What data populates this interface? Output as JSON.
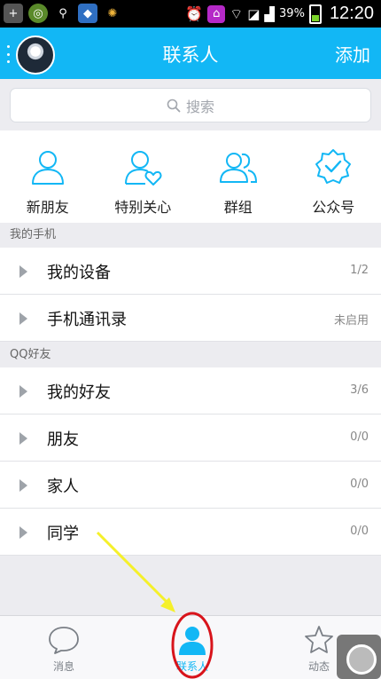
{
  "status_bar": {
    "battery_pct": "39%",
    "time": "12:20"
  },
  "header": {
    "title": "联系人",
    "add_label": "添加"
  },
  "search": {
    "placeholder": "搜索"
  },
  "quick_entries": [
    {
      "label": "新朋友",
      "icon": "person-icon"
    },
    {
      "label": "特别关心",
      "icon": "person-heart-icon"
    },
    {
      "label": "群组",
      "icon": "group-icon"
    },
    {
      "label": "公众号",
      "icon": "badge-check-icon"
    }
  ],
  "sections": [
    {
      "title": "我的手机",
      "rows": [
        {
          "name": "我的设备",
          "count": "1/2"
        },
        {
          "name": "手机通讯录",
          "count": "未启用"
        }
      ]
    },
    {
      "title": "QQ好友",
      "rows": [
        {
          "name": "我的好友",
          "count": "3/6"
        },
        {
          "name": "朋友",
          "count": "0/0"
        },
        {
          "name": "家人",
          "count": "0/0"
        },
        {
          "name": "同学",
          "count": "0/0"
        }
      ]
    }
  ],
  "tabs": [
    {
      "label": "消息",
      "icon": "chat-bubble-icon",
      "active": false
    },
    {
      "label": "联系人",
      "icon": "contact-person-icon",
      "active": true
    },
    {
      "label": "动态",
      "icon": "star-icon",
      "active": false
    }
  ],
  "colors": {
    "accent": "#12b7f5",
    "annotation_arrow": "#f5f02a",
    "annotation_circle": "#d8141b"
  }
}
